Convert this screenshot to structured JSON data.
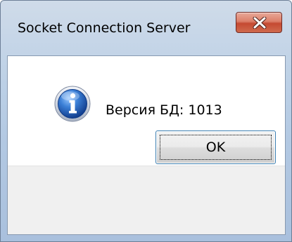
{
  "window": {
    "title": "Socket Connection Server"
  },
  "titlebar": {
    "close_icon": "close-x-icon"
  },
  "message": {
    "icon": "information-icon",
    "text": "Версия БД: 1013"
  },
  "buttons": {
    "ok_label": "OK"
  },
  "colors": {
    "close_button": "#c94a30",
    "focus_border": "#3c7fb1",
    "info_icon_blue": "#1f5fb8"
  }
}
